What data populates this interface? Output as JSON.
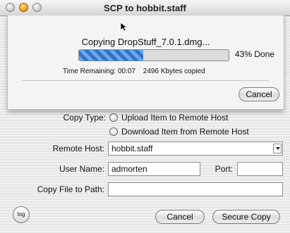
{
  "window": {
    "title": "SCP to hobbit.staff"
  },
  "sheet": {
    "status": "Copying DropStuff_7.0.1.dmg...",
    "progress": 43,
    "percent_label": "43% Done",
    "time_remaining": "Time Remaining: 00:07",
    "bytes_copied": "2496 Kbytes copied",
    "cancel_label": "Cancel"
  },
  "form": {
    "copy_type_label": "Copy Type:",
    "option_upload": "Upload Item to Remote Host",
    "option_download": "Download Item from Remote Host",
    "remote_host_label": "Remote Host:",
    "remote_host_value": "hobbit.staff",
    "user_name_label": "User Name:",
    "user_name_value": "admorten",
    "port_label": "Port:",
    "port_value": "",
    "path_label": "Copy File to Path:",
    "path_value": ""
  },
  "buttons": {
    "log": "log",
    "cancel": "Cancel",
    "secure_copy": "Secure Copy"
  },
  "colors": {
    "accent": "#2f73c9"
  }
}
